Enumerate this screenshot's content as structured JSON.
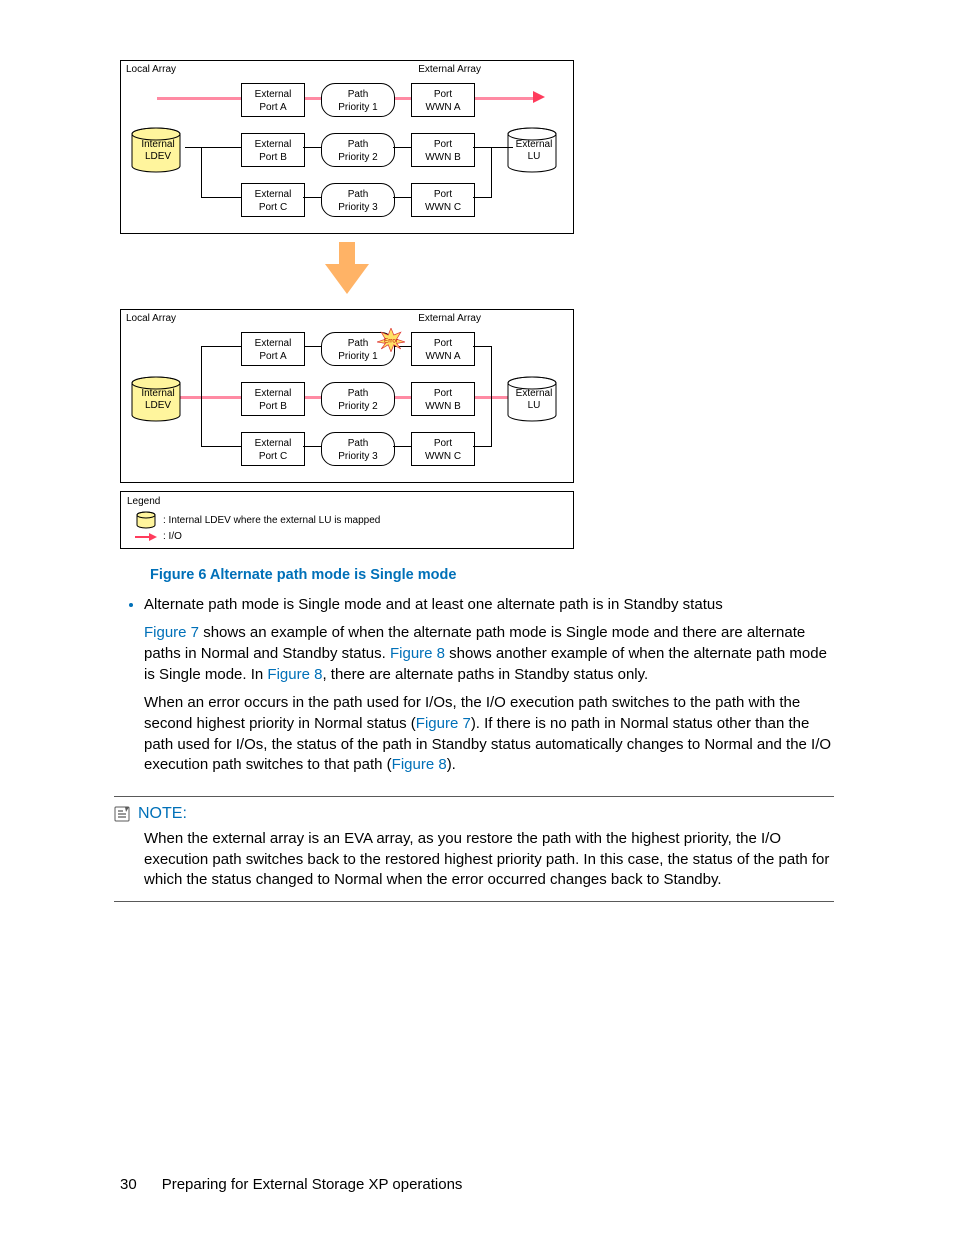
{
  "figure": {
    "diagram1": {
      "localArray": "Local Array",
      "externalArray": "External Array",
      "internalLdev": "Internal\nLDEV",
      "externalLu": "External\nLU",
      "rows": [
        {
          "port": "External\nPort A",
          "path": "Path\nPriority 1",
          "wwn": "Port\nWWN A"
        },
        {
          "port": "External\nPort B",
          "path": "Path\nPriority 2",
          "wwn": "Port\nWWN B"
        },
        {
          "port": "External\nPort C",
          "path": "Path\nPriority 3",
          "wwn": "Port\nWWN C"
        }
      ],
      "activePath": 0,
      "error": false
    },
    "diagram2": {
      "localArray": "Local Array",
      "externalArray": "External Array",
      "internalLdev": "Internal\nLDEV",
      "externalLu": "External\nLU",
      "rows": [
        {
          "port": "External\nPort A",
          "path": "Path\nPriority 1",
          "wwn": "Port\nWWN A"
        },
        {
          "port": "External\nPort B",
          "path": "Path\nPriority 2",
          "wwn": "Port\nWWN B"
        },
        {
          "port": "External\nPort C",
          "path": "Path\nPriority 3",
          "wwn": "Port\nWWN C"
        }
      ],
      "activePath": 1,
      "errorLabel": "Error"
    },
    "legend": {
      "title": "Legend",
      "cyl": ": Internal LDEV where the external LU is mapped",
      "arrow": ": I/O"
    },
    "caption": "Figure 6 Alternate path mode is Single mode"
  },
  "bullet": {
    "lead": "Alternate path mode is Single mode and at least one alternate path is in Standby status",
    "p1a": " shows an example of when the alternate path mode is Single mode and there are alternate paths in Normal and Standby status. ",
    "p1b": " shows another example of when the alternate path mode is Single mode. In ",
    "p1c": ", there are alternate paths in Standby status only.",
    "p2a": "When an error occurs in the path used for I/Os, the I/O execution path switches to the path with the second highest priority in Normal status (",
    "p2b": "). If there is no path in Normal status other than the path used for I/Os, the status of the path in Standby status automatically changes to Normal and the I/O execution path switches to that path (",
    "p2c": ").",
    "fig7": "Figure 7",
    "fig8": "Figure 8"
  },
  "note": {
    "label": "NOTE:",
    "text": "When the external array is an EVA array, as you restore the path with the highest priority, the I/O execution path switches back to the restored highest priority path. In this case, the status of the path for which the status changed to Normal when the error occurred changes back to Standby."
  },
  "footer": {
    "pageNum": "30",
    "chapter": "Preparing for External Storage XP operations"
  }
}
